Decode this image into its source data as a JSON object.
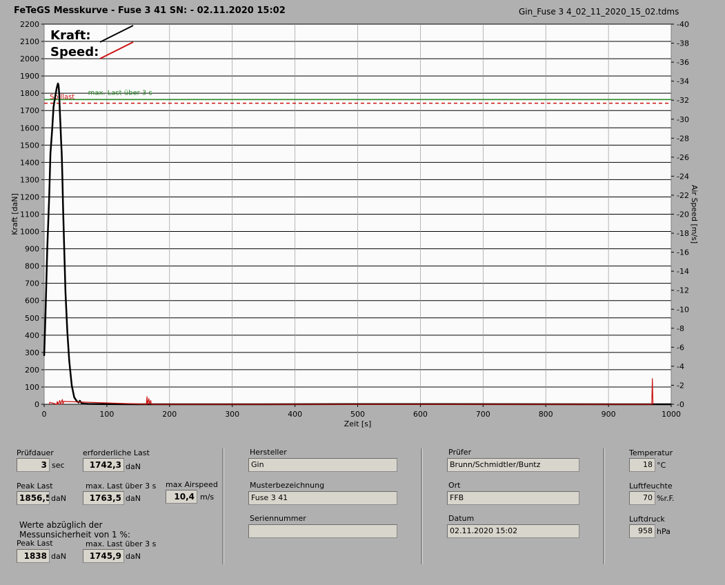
{
  "header": {
    "title": "FeTeGS Messkurve - Fuse 3 41  SN:  - 02.11.2020 15:02",
    "file": "Gin_Fuse 3 4_02_11_2020_15_02.tdms"
  },
  "chart_data": {
    "type": "line",
    "xlabel": "Zeit [s]",
    "ylabel": "Kraft [daN]",
    "y2label": "Air Speed [m/s]",
    "xlim": [
      0,
      1000
    ],
    "ylim": [
      0,
      2200
    ],
    "y2lim": [
      0,
      40
    ],
    "xticks": [
      0,
      100,
      200,
      300,
      400,
      500,
      600,
      700,
      800,
      900,
      1000
    ],
    "yticks": [
      0,
      100,
      200,
      300,
      400,
      500,
      600,
      700,
      800,
      900,
      1000,
      1100,
      1200,
      1300,
      1400,
      1500,
      1600,
      1700,
      1800,
      1900,
      2000,
      2100,
      2200
    ],
    "y2ticks": [
      0,
      2,
      4,
      6,
      8,
      10,
      12,
      14,
      16,
      18,
      20,
      22,
      24,
      26,
      28,
      30,
      32,
      34,
      36,
      38,
      40
    ],
    "grid": true,
    "legend_position": "top-left",
    "series": [
      {
        "name": "Kraft:",
        "color": "#000000",
        "axis": "left",
        "x": [
          0,
          2,
          5,
          8,
          10,
          13,
          15,
          18,
          20,
          22,
          23,
          24,
          25,
          26,
          27,
          28,
          29,
          30,
          32,
          34,
          37,
          40,
          44,
          48,
          52,
          55,
          57,
          60,
          65,
          70,
          90,
          150,
          300,
          600,
          970,
          1000
        ],
        "y": [
          280,
          500,
          900,
          1200,
          1450,
          1600,
          1720,
          1790,
          1830,
          1856.5,
          1845,
          1800,
          1700,
          1620,
          1530,
          1450,
          1320,
          1160,
          900,
          650,
          420,
          250,
          110,
          40,
          18,
          10,
          20,
          5,
          3,
          2,
          1,
          0,
          0,
          1,
          0,
          0
        ]
      },
      {
        "name": "Speed:",
        "color": "#cc1111",
        "axis": "right",
        "x": [
          8,
          9,
          20,
          21,
          22,
          25,
          26,
          29,
          30,
          31,
          163,
          164,
          165,
          167,
          168,
          170,
          171,
          969,
          970,
          971
        ],
        "y": [
          0,
          0.2,
          0,
          0.3,
          0,
          0.4,
          0,
          0.5,
          0,
          0.3,
          0,
          0.8,
          0,
          0.6,
          0,
          0.4,
          0,
          0,
          2.7,
          0
        ]
      }
    ],
    "reference_lines": [
      {
        "label": "max. Last über  3 s",
        "value": 1763.5,
        "color": "#2a8a2a",
        "style": "solid"
      },
      {
        "label": "Solllast",
        "value": 1742.3,
        "color": "#cc1111",
        "style": "dashed"
      }
    ]
  },
  "legend": {
    "kraft": "Kraft:",
    "speed": "Speed:"
  },
  "results": {
    "pruefdauer_label": "Prüfdauer",
    "pruefdauer_value": "3",
    "pruefdauer_unit": "sec",
    "erf_last_label": "erforderliche Last",
    "erf_last_value": "1742,3",
    "erf_last_unit": "daN",
    "peak_last_label": "Peak Last",
    "peak_last_value": "1856,5",
    "peak_last_unit": "daN",
    "max_last_label": "max. Last über  3 s",
    "max_last_value": "1763,5",
    "max_last_unit": "daN",
    "max_airspeed_label": "max Airspeed",
    "max_airspeed_value": "10,4",
    "max_airspeed_unit": "m/s",
    "note_line1": "Werte abzüglich der",
    "note_line2": "Messunsicherheit von 1  %:",
    "peak2_label": "Peak Last",
    "peak2_value": "1838",
    "peak2_unit": "daN",
    "max2_label": "max. Last über  3 s",
    "max2_value": "1745,9",
    "max2_unit": "daN"
  },
  "info": {
    "hersteller_label": "Hersteller",
    "hersteller_value": "Gin",
    "muster_label": "Musterbezeichnung",
    "muster_value": "Fuse 3 41",
    "serien_label": "Seriennummer",
    "serien_value": "",
    "pruefer_label": "Prüfer",
    "pruefer_value": "Brunn/Schmidtler/Buntz",
    "ort_label": "Ort",
    "ort_value": "FFB",
    "datum_label": "Datum",
    "datum_value": "02.11.2020 15:02"
  },
  "env": {
    "temp_label": "Temperatur",
    "temp_value": "18",
    "temp_unit": "°C",
    "feuchte_label": "Luftfeuchte",
    "feuchte_value": "70",
    "feuchte_unit": "%r.F.",
    "druck_label": "Luftdruck",
    "druck_value": "958",
    "druck_unit": "hPa"
  }
}
